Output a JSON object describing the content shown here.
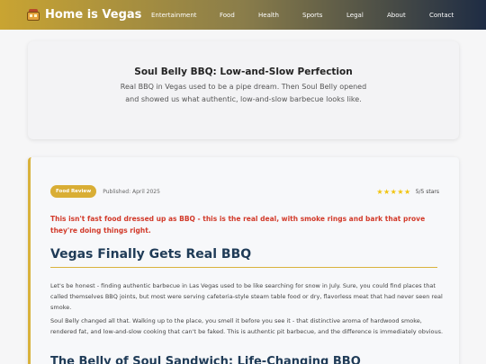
{
  "nav": {
    "brand": "Home is Vegas",
    "brand_icon": "casino-building-icon",
    "links": [
      "Entertainment",
      "Food",
      "Health",
      "Sports",
      "Legal",
      "About",
      "Contact"
    ]
  },
  "hero": {
    "title": "Soul Belly BBQ: Low-and-Slow Perfection",
    "subtitle": "Real BBQ in Vegas used to be a pipe dream. Then Soul Belly opened and showed us what authentic, low-and-slow barbecue looks like."
  },
  "article": {
    "badge": "Food Review",
    "published": "Published: April 2025",
    "stars": "★★★★★",
    "rating": "5/5 stars",
    "intro": "This isn't fast food dressed up as BBQ - this is the real deal, with smoke rings and bark that prove they're doing things right.",
    "heading": "Vegas Finally Gets Real BBQ",
    "para1": "Let's be honest - finding authentic barbecue in Las Vegas used to be like searching for snow in July. Sure, you could find places that called themselves BBQ joints, but most were serving cafeteria-style steam table food or dry, flavorless meat that had never seen real smoke.",
    "para2": "Soul Belly changed all that. Walking up to the place, you smell it before you see it - that distinctive aroma of hardwood smoke, rendered fat, and low-and-slow cooking that can't be faked. This is authentic pit barbecue, and the difference is immediately obvious.",
    "subheading": "The Belly of Soul Sandwich: Life-Changing BBQ"
  },
  "colors": {
    "accent": "#d9b23c",
    "heading": "#1f3b57",
    "alert": "#d23a2a"
  }
}
